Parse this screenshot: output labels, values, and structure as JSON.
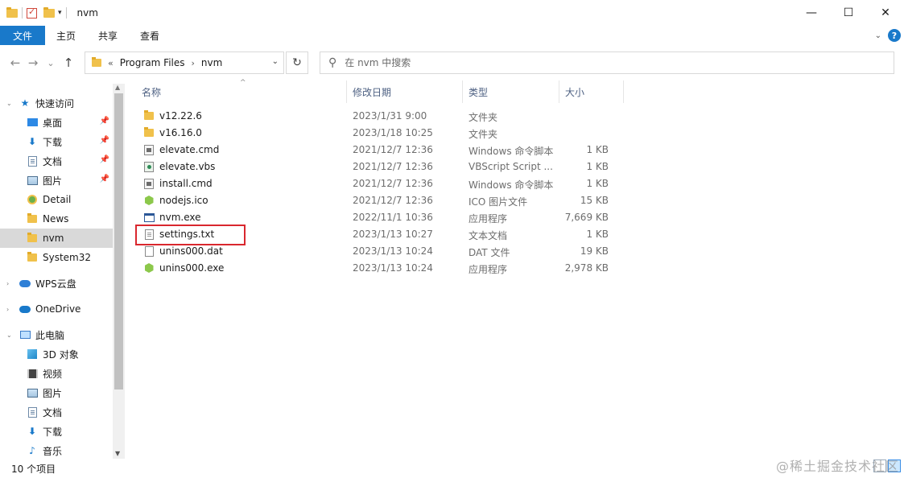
{
  "window": {
    "title": "nvm",
    "minimize": "—",
    "maximize": "☐",
    "close": "✕"
  },
  "ribbon": {
    "tabs": [
      "文件",
      "主页",
      "共享",
      "查看"
    ],
    "help": "?"
  },
  "nav": {
    "back": "←",
    "forward": "→",
    "recent": "⌄",
    "up": "↑",
    "crumbs": [
      "Program Files",
      "nvm"
    ],
    "crumb_prefix": "«",
    "crumb_sep": "›",
    "refresh": "↻"
  },
  "search": {
    "placeholder": "在 nvm 中搜索"
  },
  "sidebar": {
    "items": [
      {
        "label": "快速访问",
        "icon": "star-icon",
        "pinned": false
      },
      {
        "label": "桌面",
        "icon": "desktop-icon",
        "pinned": true
      },
      {
        "label": "下载",
        "icon": "download-icon",
        "pinned": true
      },
      {
        "label": "文档",
        "icon": "documents-icon",
        "pinned": true
      },
      {
        "label": "图片",
        "icon": "pictures-icon",
        "pinned": true
      },
      {
        "label": "Detail",
        "icon": "detail-icon",
        "pinned": false
      },
      {
        "label": "News",
        "icon": "folder-icon",
        "pinned": false
      },
      {
        "label": "nvm",
        "icon": "folder-icon",
        "pinned": false,
        "selected": true
      },
      {
        "label": "System32",
        "icon": "folder-icon",
        "pinned": false
      },
      {
        "label": "WPS云盘",
        "icon": "wps-cloud-icon",
        "pinned": false
      },
      {
        "label": "OneDrive",
        "icon": "onedrive-icon",
        "pinned": false
      },
      {
        "label": "此电脑",
        "icon": "this-pc-icon",
        "pinned": false
      },
      {
        "label": "3D 对象",
        "icon": "3d-objects-icon",
        "pinned": false
      },
      {
        "label": "视频",
        "icon": "videos-icon",
        "pinned": false
      },
      {
        "label": "图片",
        "icon": "pictures-icon",
        "pinned": false
      },
      {
        "label": "文档",
        "icon": "documents-icon",
        "pinned": false
      },
      {
        "label": "下载",
        "icon": "download-icon",
        "pinned": false
      },
      {
        "label": "音乐",
        "icon": "music-icon",
        "pinned": false
      }
    ]
  },
  "columns": {
    "name": "名称",
    "date": "修改日期",
    "type": "类型",
    "size": "大小"
  },
  "files": [
    {
      "name": "v12.22.6",
      "date": "2023/1/31 9:00",
      "type": "文件夹",
      "size": "",
      "icon": "folder-icon"
    },
    {
      "name": "v16.16.0",
      "date": "2023/1/18 10:25",
      "type": "文件夹",
      "size": "",
      "icon": "folder-icon"
    },
    {
      "name": "elevate.cmd",
      "date": "2021/12/7 12:36",
      "type": "Windows 命令脚本",
      "size": "1 KB",
      "icon": "cmd-file-icon"
    },
    {
      "name": "elevate.vbs",
      "date": "2021/12/7 12:36",
      "type": "VBScript Script ...",
      "size": "1 KB",
      "icon": "vbs-file-icon"
    },
    {
      "name": "install.cmd",
      "date": "2021/12/7 12:36",
      "type": "Windows 命令脚本",
      "size": "1 KB",
      "icon": "cmd-file-icon"
    },
    {
      "name": "nodejs.ico",
      "date": "2021/12/7 12:36",
      "type": "ICO 图片文件",
      "size": "15 KB",
      "icon": "nodejs-icon"
    },
    {
      "name": "nvm.exe",
      "date": "2022/11/1 10:36",
      "type": "应用程序",
      "size": "7,669 KB",
      "icon": "exe-file-icon"
    },
    {
      "name": "settings.txt",
      "date": "2023/1/13 10:27",
      "type": "文本文档",
      "size": "1 KB",
      "icon": "txt-file-icon"
    },
    {
      "name": "unins000.dat",
      "date": "2023/1/13 10:24",
      "type": "DAT 文件",
      "size": "19 KB",
      "icon": "dat-file-icon"
    },
    {
      "name": "unins000.exe",
      "date": "2023/1/13 10:24",
      "type": "应用程序",
      "size": "2,978 KB",
      "icon": "nodejs-icon"
    }
  ],
  "status": {
    "item_count": "10 个项目"
  },
  "watermark": "@稀土掘金技术社区"
}
